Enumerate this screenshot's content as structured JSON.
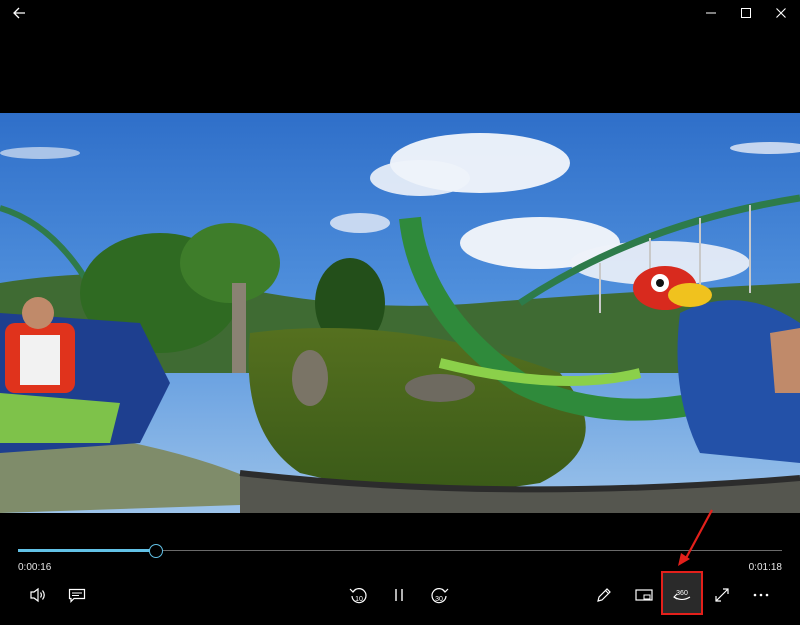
{
  "titlebar": {
    "back": "back-arrow-icon",
    "minimize": "minimize-icon",
    "maximize": "maximize-icon",
    "close": "close-icon"
  },
  "video": {
    "description_icon": "360-video-frame"
  },
  "seek": {
    "progress": 0.18,
    "elapsed": "0:00:16",
    "total": "0:01:18"
  },
  "controls": {
    "volume": "volume-icon",
    "subtitles": "subtitles-icon",
    "skip_back": {
      "icon": "skip-back-icon",
      "label": "10"
    },
    "play_pause": "pause-icon",
    "skip_forward": {
      "icon": "skip-forward-icon",
      "label": "30"
    },
    "edit": "pencil-icon",
    "mini_view": "mini-view-icon",
    "view_360": {
      "icon": "360-icon",
      "label": "360"
    },
    "fullscreen": "fullscreen-icon",
    "more": "more-icon"
  },
  "colors": {
    "accent": "#62c1e6",
    "annotation": "#e3201b"
  }
}
